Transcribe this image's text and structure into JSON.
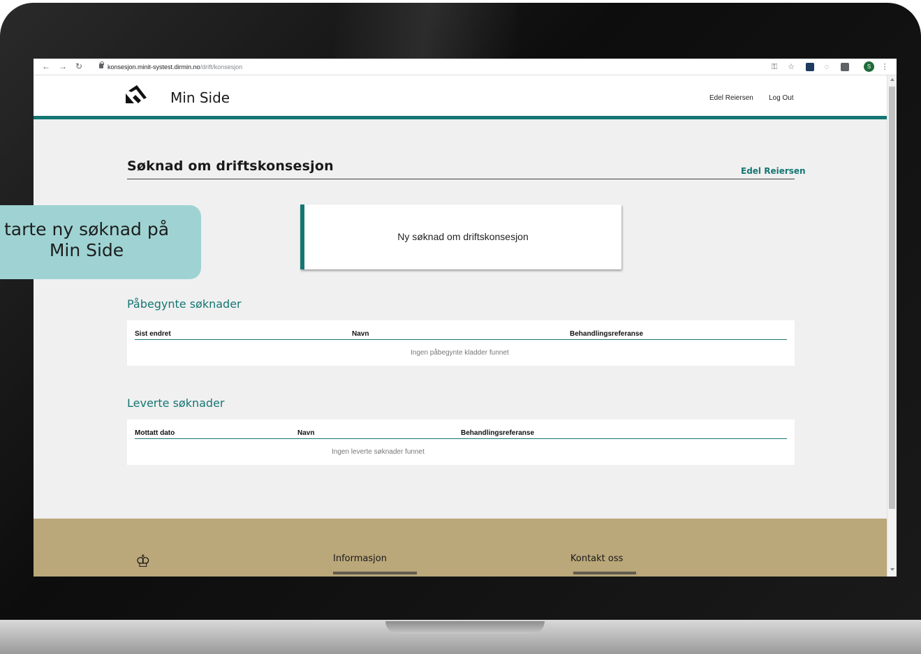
{
  "browser": {
    "url_host": "konsesjon.minit-systest.dirmin.no",
    "url_path": "/drift/konsesjon",
    "profile_initial": "S"
  },
  "header": {
    "site_title": "Min Side",
    "user_name": "Edel Reiersen",
    "logout_label": "Log Out",
    "accent_color": "#157673"
  },
  "page": {
    "heading": "Søknad om driftskonsesjon",
    "heading_user": "Edel Reiersen",
    "new_application_label": "Ny søknad om driftskonsesjon"
  },
  "started": {
    "title": "Påbegynte søknader",
    "columns": [
      "Sist endret",
      "Navn",
      "Behandlingsreferanse"
    ],
    "empty_message": "Ingen påbegynte kladder funnet"
  },
  "delivered": {
    "title": "Leverte søknader",
    "columns": [
      "Mottatt dato",
      "Navn",
      "Behandlingsreferanse"
    ],
    "empty_message": "Ingen leverte søknader funnet"
  },
  "footer": {
    "info_title": "Informasjon",
    "contact_title": "Kontakt oss",
    "background_color": "#baa77a"
  },
  "callout": {
    "line1": "tarte ny søknad på",
    "line2": "Min Side",
    "color": "#9fd3d3"
  }
}
